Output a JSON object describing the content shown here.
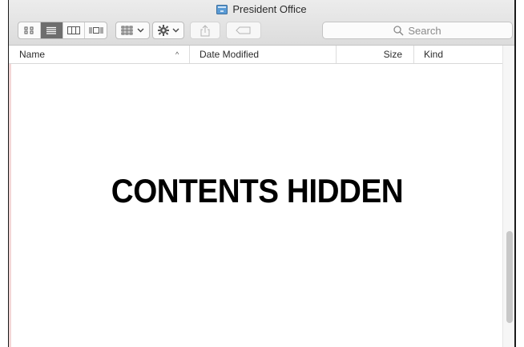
{
  "window": {
    "title": "President Office"
  },
  "toolbar": {
    "view_buttons": [
      {
        "name": "icon-view",
        "active": false
      },
      {
        "name": "list-view",
        "active": true
      },
      {
        "name": "column-view",
        "active": false
      },
      {
        "name": "cover-flow-view",
        "active": false
      }
    ],
    "search_placeholder": "Search"
  },
  "list_header": {
    "name": "Name",
    "date_modified": "Date Modified",
    "size": "Size",
    "kind": "Kind",
    "sort_indicator": "^"
  },
  "content": {
    "overlay_text": "CONTENTS HIDDEN"
  },
  "colors": {
    "active_segment": "#6e6e6e",
    "titlebar": "#e4e4e4"
  }
}
